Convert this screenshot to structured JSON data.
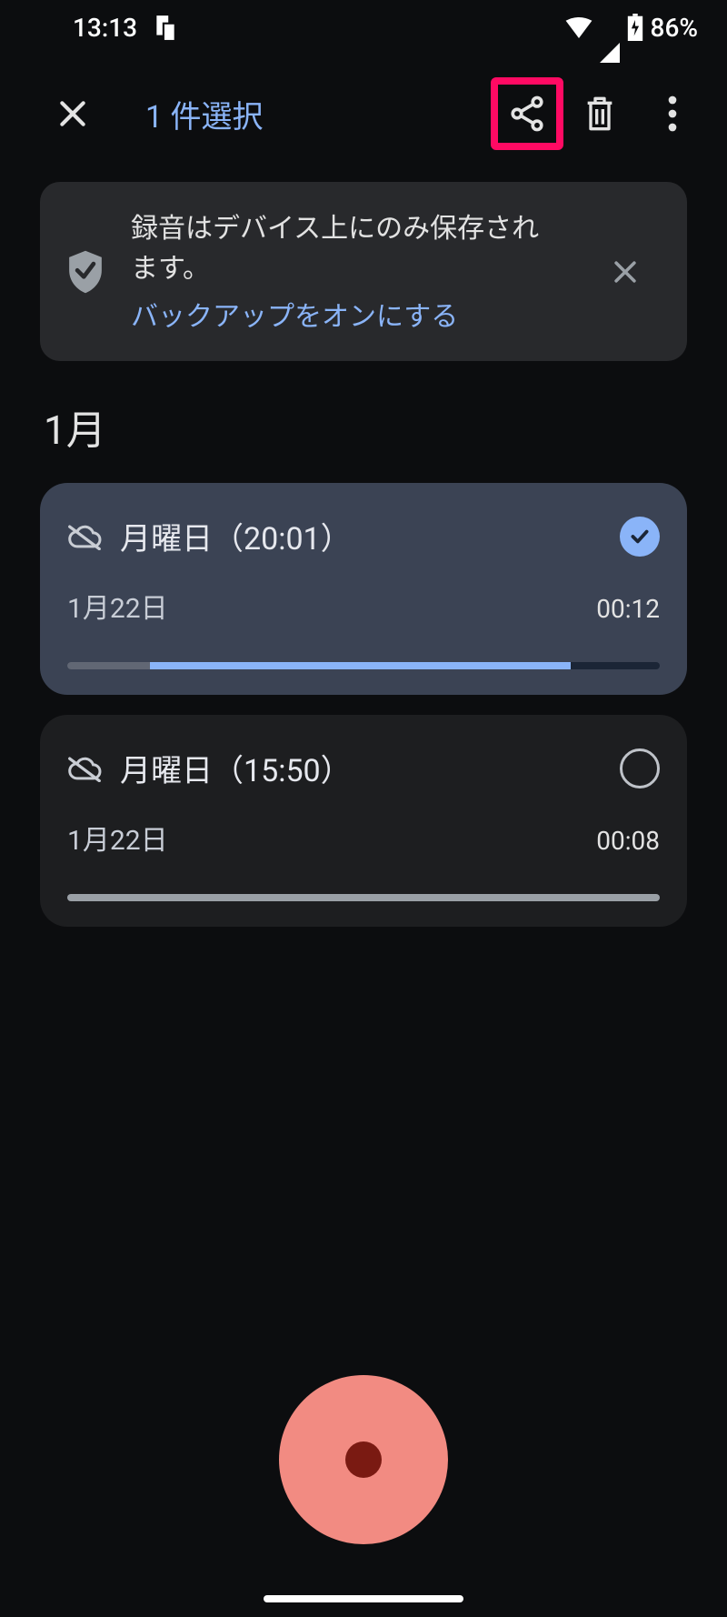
{
  "status": {
    "time": "13:13",
    "battery": "86%"
  },
  "app_bar": {
    "selection_count": "1 件選択"
  },
  "banner": {
    "text": "録音はデバイス上にのみ保存されます。",
    "link": "バックアップをオンにする"
  },
  "section_header": "1月",
  "recordings": [
    {
      "title": "月曜日（20:01）",
      "date": "1月22日",
      "duration": "00:12",
      "selected": true,
      "progress_a_pct": 14,
      "progress_b_pct": 71
    },
    {
      "title": "月曜日（15:50）",
      "date": "1月22日",
      "duration": "00:08",
      "selected": false,
      "progress_a_pct": 100,
      "progress_b_pct": 0
    }
  ]
}
